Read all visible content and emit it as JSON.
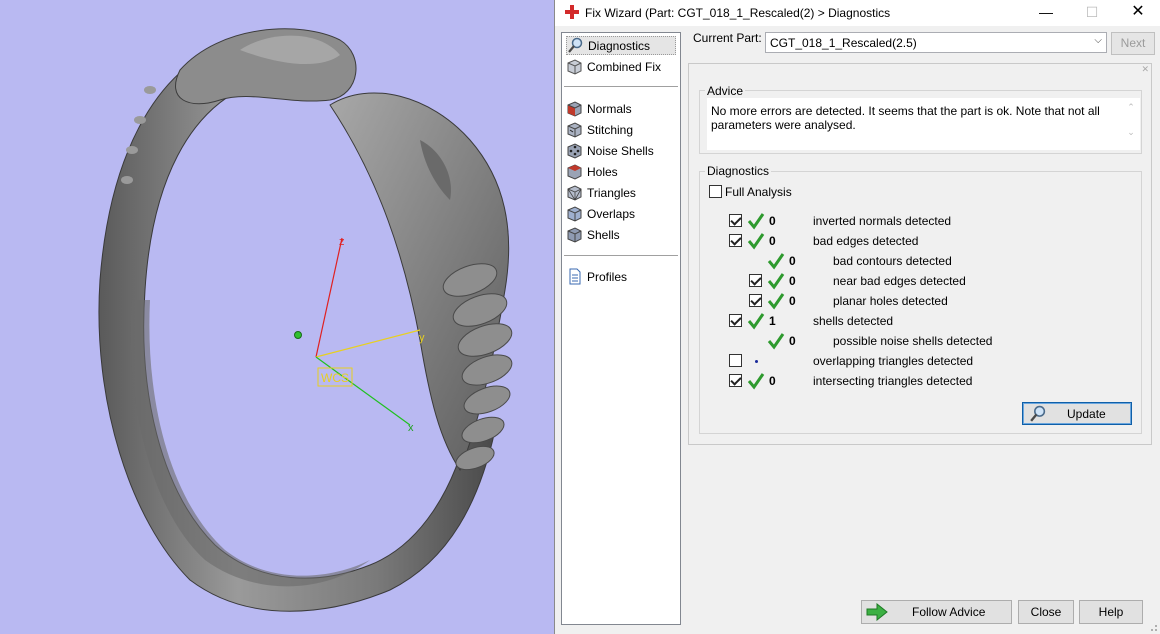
{
  "window": {
    "title": "Fix Wizard (Part: CGT_018_1_Rescaled(2) > Diagnostics",
    "min_glyph": "—",
    "max_glyph": "☐",
    "close_glyph": "✕",
    "icon": "red-cross-icon"
  },
  "viewport": {
    "axis_x": "x",
    "axis_y": "y",
    "axis_z": "z",
    "wcs_label": "WCS",
    "background": "#b9b9f2"
  },
  "nav": {
    "items": [
      {
        "label": "Diagnostics",
        "icon": "magnifier-icon"
      },
      {
        "label": "Combined Fix",
        "icon": "cube-icon"
      },
      {
        "label": "Normals",
        "icon": "cube-red-icon"
      },
      {
        "label": "Stitching",
        "icon": "cube-stitch-icon"
      },
      {
        "label": "Noise Shells",
        "icon": "cube-dots-icon"
      },
      {
        "label": "Holes",
        "icon": "cube-hole-icon"
      },
      {
        "label": "Triangles",
        "icon": "cube-triangles-icon"
      },
      {
        "label": "Overlaps",
        "icon": "cube-overlap-icon"
      },
      {
        "label": "Shells",
        "icon": "cube-shells-icon"
      },
      {
        "label": "Profiles",
        "icon": "document-icon"
      }
    ],
    "selected": "Diagnostics"
  },
  "top": {
    "current_part_label": "Current Part:",
    "current_part_value": "CGT_018_1_Rescaled(2.5)",
    "next_label": "Next"
  },
  "advice": {
    "label": "Advice",
    "text": "No more errors are detected. It seems that the part is ok. Note that not all parameters were analysed."
  },
  "diagnostics": {
    "label": "Diagnostics",
    "full_analysis_label": "Full Analysis",
    "full_analysis_checked": false,
    "rows": [
      {
        "checked": true,
        "status": "ok",
        "count": "0",
        "label": "inverted normals detected",
        "indent": 0
      },
      {
        "checked": true,
        "status": "ok",
        "count": "0",
        "label": "bad edges detected",
        "indent": 0
      },
      {
        "checked": null,
        "status": "ok",
        "count": "0",
        "label": "bad contours detected",
        "indent": 1
      },
      {
        "checked": true,
        "status": "ok",
        "count": "0",
        "label": "near bad edges detected",
        "indent": 1
      },
      {
        "checked": true,
        "status": "ok",
        "count": "0",
        "label": "planar holes detected",
        "indent": 1
      },
      {
        "checked": true,
        "status": "ok",
        "count": "1",
        "label": "shells detected",
        "indent": 0
      },
      {
        "checked": null,
        "status": "ok",
        "count": "0",
        "label": "possible noise shells detected",
        "indent": 1
      },
      {
        "checked": false,
        "status": "none",
        "count": "",
        "label": "overlapping triangles detected",
        "indent": 0
      },
      {
        "checked": true,
        "status": "ok",
        "count": "0",
        "label": "intersecting triangles detected",
        "indent": 0
      }
    ],
    "update_label": "Update"
  },
  "footer": {
    "follow_label": "Follow Advice",
    "close_label": "Close",
    "help_label": "Help"
  },
  "colors": {
    "accent": "#0f5fa8",
    "ok_green": "#2e9a2e",
    "title_icon": "#d32a2a"
  }
}
